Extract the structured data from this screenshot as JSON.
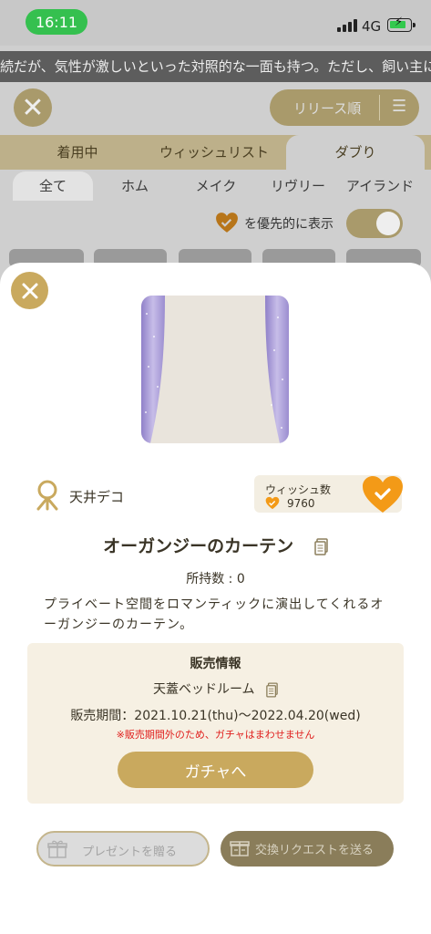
{
  "status_bar": {
    "time": "16:11",
    "network": "4G"
  },
  "background": {
    "ticker_text": "続だが、気性が激しいといった対照的な一面も持つ。ただし、飼い主に",
    "sort_label": "リリース順",
    "tabs": [
      "着用中",
      "ウィッシュリスト",
      "ダブり"
    ],
    "subtabs": [
      "全て",
      "ホム",
      "メイク",
      "リヴリー",
      "アイランド"
    ],
    "priority_label": "を優先的に表示"
  },
  "modal": {
    "category": "天井デコ",
    "wish_label": "ウィッシュ数",
    "wish_count": "9760",
    "item_name": "オーガンジーのカーテン",
    "owned": "所持数 : 0",
    "description": "プライベート空間をロマンティックに演出してくれるオーガンジーのカーテン。",
    "sales": {
      "heading": "販売情報",
      "room": "天蓋ベッドルーム",
      "period": "販売期間：2021.10.21(thu)〜2022.04.20(wed)",
      "warning": "※販売期間外のため、ガチャはまわせません",
      "gacha_button": "ガチャへ"
    },
    "present_button": "プレゼントを贈る",
    "exchange_button": "交換リクエストを送る"
  },
  "colors": {
    "accent": "#c9a95e",
    "heart": "#f39a17",
    "warning": "#e0201e"
  }
}
